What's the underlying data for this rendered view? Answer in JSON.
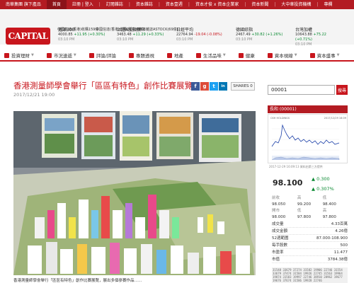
{
  "topbar": {
    "items": [
      "南華集團 旗下產品",
      "首頁",
      "註冊 | 登入",
      "訂閱雜誌",
      "資本雜誌",
      "資本壹週",
      "資本才俊 x 資本企業家",
      "資本新聞",
      "大中華投資機構",
      "專欄"
    ]
  },
  "header": {
    "logo": "CAPITAL",
    "tickers": [
      {
        "name": "滬深300",
        "value": "4000.85",
        "change": "+11.95 (+0.30%)",
        "time": "03:10 PM",
        "dir": "up"
      },
      {
        "name": "上證A股指數",
        "value": "3463.48",
        "change": "+11.29 (+0.33%)",
        "time": "03:10 PM",
        "dir": "up"
      },
      {
        "name": "日經平均",
        "value": "22764.94",
        "change": "-19.04 (-0.08%)",
        "time": "03:10 PM",
        "dir": "down"
      },
      {
        "name": "德國綜指",
        "value": "2467.49",
        "change": "+30.82 (+1.26%)",
        "time": "03:10 PM",
        "dir": "up"
      },
      {
        "name": "台灣加權",
        "value": "10643.88",
        "change": "+75.22 (+0.71%)",
        "time": "03:10 PM",
        "dir": "up"
      }
    ],
    "headlines": [
      "中國信達(香港)收購159億",
      "中國信達(香港)收購28億(69億)",
      "資本雜誌ASTOCK(69億)"
    ]
  },
  "nav": {
    "items": [
      "投資理財",
      "市況速遞",
      "評論/評論",
      "專題透視",
      "地產",
      "生活品味",
      "健康",
      "資本視線",
      "資本盛事"
    ]
  },
  "article": {
    "title": "香港測量師學會舉行「區區有特色」創作比賽展覽",
    "date": "2017/12/21 19:00",
    "shares_label": "SHARES 0",
    "caption": "香港測量師學會舉行「區區有特色」創作比賽展覽，展出多個參賽作品……"
  },
  "share_buttons": [
    {
      "icon": "facebook-icon",
      "glyph": "f",
      "color": "#3b5998"
    },
    {
      "icon": "google-plus-icon",
      "glyph": "g",
      "color": "#dd4b39"
    },
    {
      "icon": "twitter-icon",
      "glyph": "t",
      "color": "#1da1f2"
    },
    {
      "icon": "linkedin-icon",
      "glyph": "in",
      "color": "#0077b5"
    },
    {
      "icon": "email-icon",
      "glyph": "✉",
      "color": "#555555"
    }
  ],
  "quote": {
    "search_value": "00001",
    "search_button": "搜尋",
    "header": "長和 (00001)",
    "chart_stamp_left": "CKH HOLDINGS",
    "chart_stamp_right": "2017/12/29 16:09",
    "chart_footer": "2017-12-29 16:09:13    資料由第三方提供",
    "price": "98.100",
    "change": "▲ 0.300",
    "pct": "▲ 0.307%",
    "table_header": [
      "前收",
      "高",
      "低"
    ],
    "table_row1": [
      "98.050",
      "99.200",
      "98.400"
    ],
    "table_header2": [
      "開市",
      "低",
      "高"
    ],
    "table_row2": [
      "98.000",
      "97.800",
      "97.800"
    ],
    "kv": [
      [
        "成交量",
        "4.33百萬"
      ],
      [
        "成交金額",
        "4.26億"
      ],
      [
        "52週範圍",
        "87.000-108.900"
      ],
      [
        "每手股數",
        "500"
      ],
      [
        "市盈率",
        "11.477"
      ],
      [
        "市值",
        "3784.38億"
      ]
    ],
    "orders": "31548 33679 37274 31582 19906 22746 31554 33679 37474 31584 19926 22745 31563 19964 19874 31583 19997 22746 38910 28962 19677 19676 37674 31586 19928 22746"
  }
}
